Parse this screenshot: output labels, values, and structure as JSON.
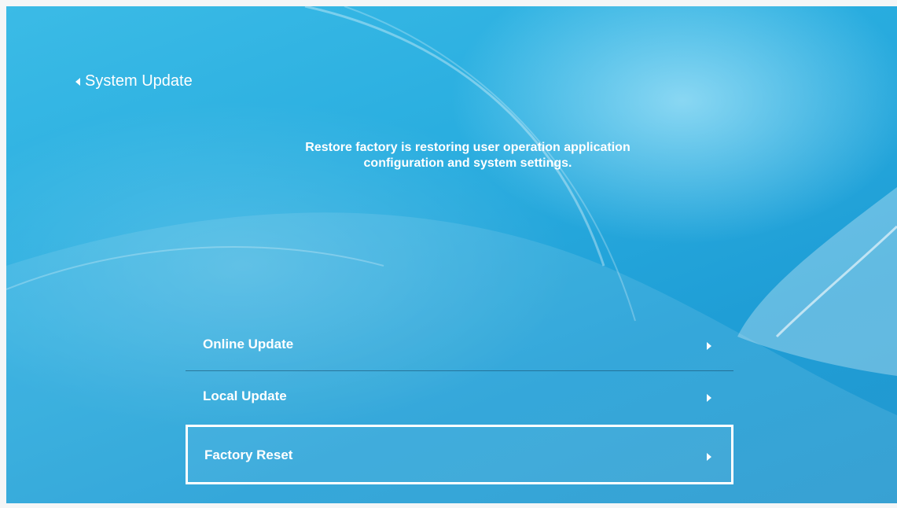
{
  "header": {
    "back_label": "System Update"
  },
  "description": "Restore factory is restoring user operation application configuration and system settings.",
  "menu": {
    "items": [
      {
        "label": "Online Update"
      },
      {
        "label": "Local Update"
      },
      {
        "label": "Factory Reset",
        "focused": true
      }
    ]
  },
  "colors": {
    "background": "#2aaee0",
    "text": "#ffffff"
  }
}
